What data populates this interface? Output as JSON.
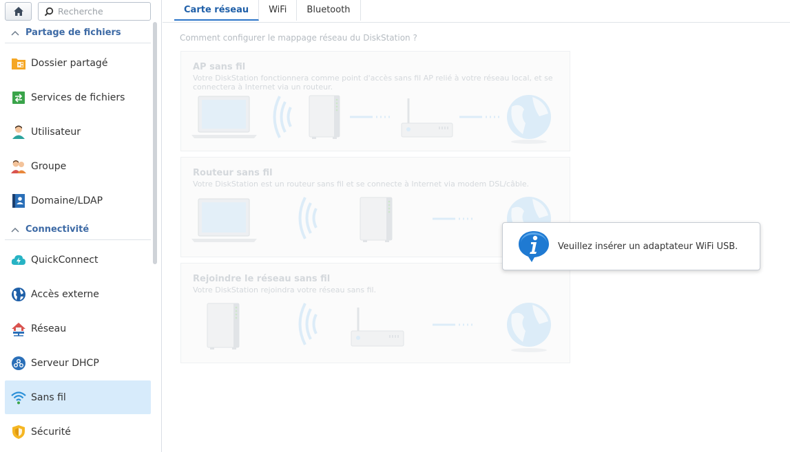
{
  "search": {
    "placeholder": "Recherche"
  },
  "sidebar": {
    "sections": [
      {
        "label": "Partage de fichiers"
      },
      {
        "label": "Connectivité"
      }
    ],
    "items": [
      {
        "label": "Dossier partagé",
        "icon": "shared-folder-icon"
      },
      {
        "label": "Services de fichiers",
        "icon": "file-services-icon"
      },
      {
        "label": "Utilisateur",
        "icon": "user-icon"
      },
      {
        "label": "Groupe",
        "icon": "group-icon"
      },
      {
        "label": "Domaine/LDAP",
        "icon": "domain-ldap-icon"
      },
      {
        "label": "QuickConnect",
        "icon": "quickconnect-icon"
      },
      {
        "label": "Accès externe",
        "icon": "external-access-icon"
      },
      {
        "label": "Réseau",
        "icon": "network-icon"
      },
      {
        "label": "Serveur DHCP",
        "icon": "dhcp-server-icon"
      },
      {
        "label": "Sans fil",
        "icon": "wireless-icon",
        "active": true
      },
      {
        "label": "Sécurité",
        "icon": "security-icon"
      }
    ]
  },
  "tabs": [
    {
      "label": "Carte réseau",
      "active": true
    },
    {
      "label": "WiFi"
    },
    {
      "label": "Bluetooth"
    }
  ],
  "main": {
    "question": "Comment configurer le mappage réseau du DiskStation ?",
    "cards": [
      {
        "title": "AP sans fil",
        "desc": "Votre DiskStation fonctionnera comme point d'accès sans fil AP relié à votre réseau local, et se connectera à Internet via un routeur."
      },
      {
        "title": "Routeur sans fil",
        "desc": "Votre DiskStation est un routeur sans fil et se connecte à Internet via modem DSL/câble."
      },
      {
        "title": "Rejoindre le réseau sans fil",
        "desc": "Votre DiskStation rejoindra votre réseau sans fil."
      }
    ]
  },
  "tooltip": {
    "message": "Veuillez insérer un adaptateur WiFi USB.",
    "icon": "info-icon"
  },
  "colors": {
    "accent": "#2a74c8",
    "active_bg": "#d7ebfb",
    "section": "#3d6aa5"
  }
}
